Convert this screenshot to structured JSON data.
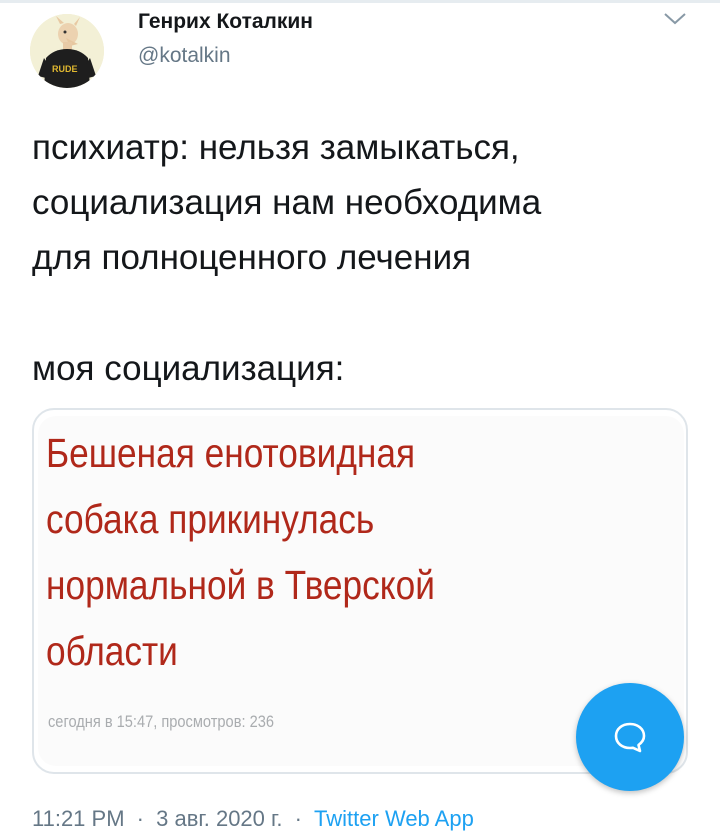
{
  "author": {
    "display_name": "Генрих Коталкин",
    "handle": "@kotalkin",
    "avatar_shirt_text": "RUDE"
  },
  "tweet": {
    "lines": [
      "психиатр: нельзя замыкаться,",
      "социализация нам необходима",
      "для полноценного лечения"
    ],
    "second_paragraph": "моя социализация:"
  },
  "media": {
    "headline_lines": [
      "Бешеная енотовидная",
      "собака прикинулась",
      "нормальной в Тверской",
      "области"
    ],
    "meta": "сегодня в 15:47, просмотров: 236"
  },
  "footer": {
    "time": "11:21 PM",
    "separator": "·",
    "date": "3 авг. 2020 г.",
    "source": "Twitter Web App"
  },
  "colors": {
    "accent": "#1da1f2",
    "headline": "#b0281a",
    "secondary_text": "#657786"
  },
  "icons": {
    "menu": "chevron-down-icon",
    "compose": "chat-bubble-icon"
  }
}
